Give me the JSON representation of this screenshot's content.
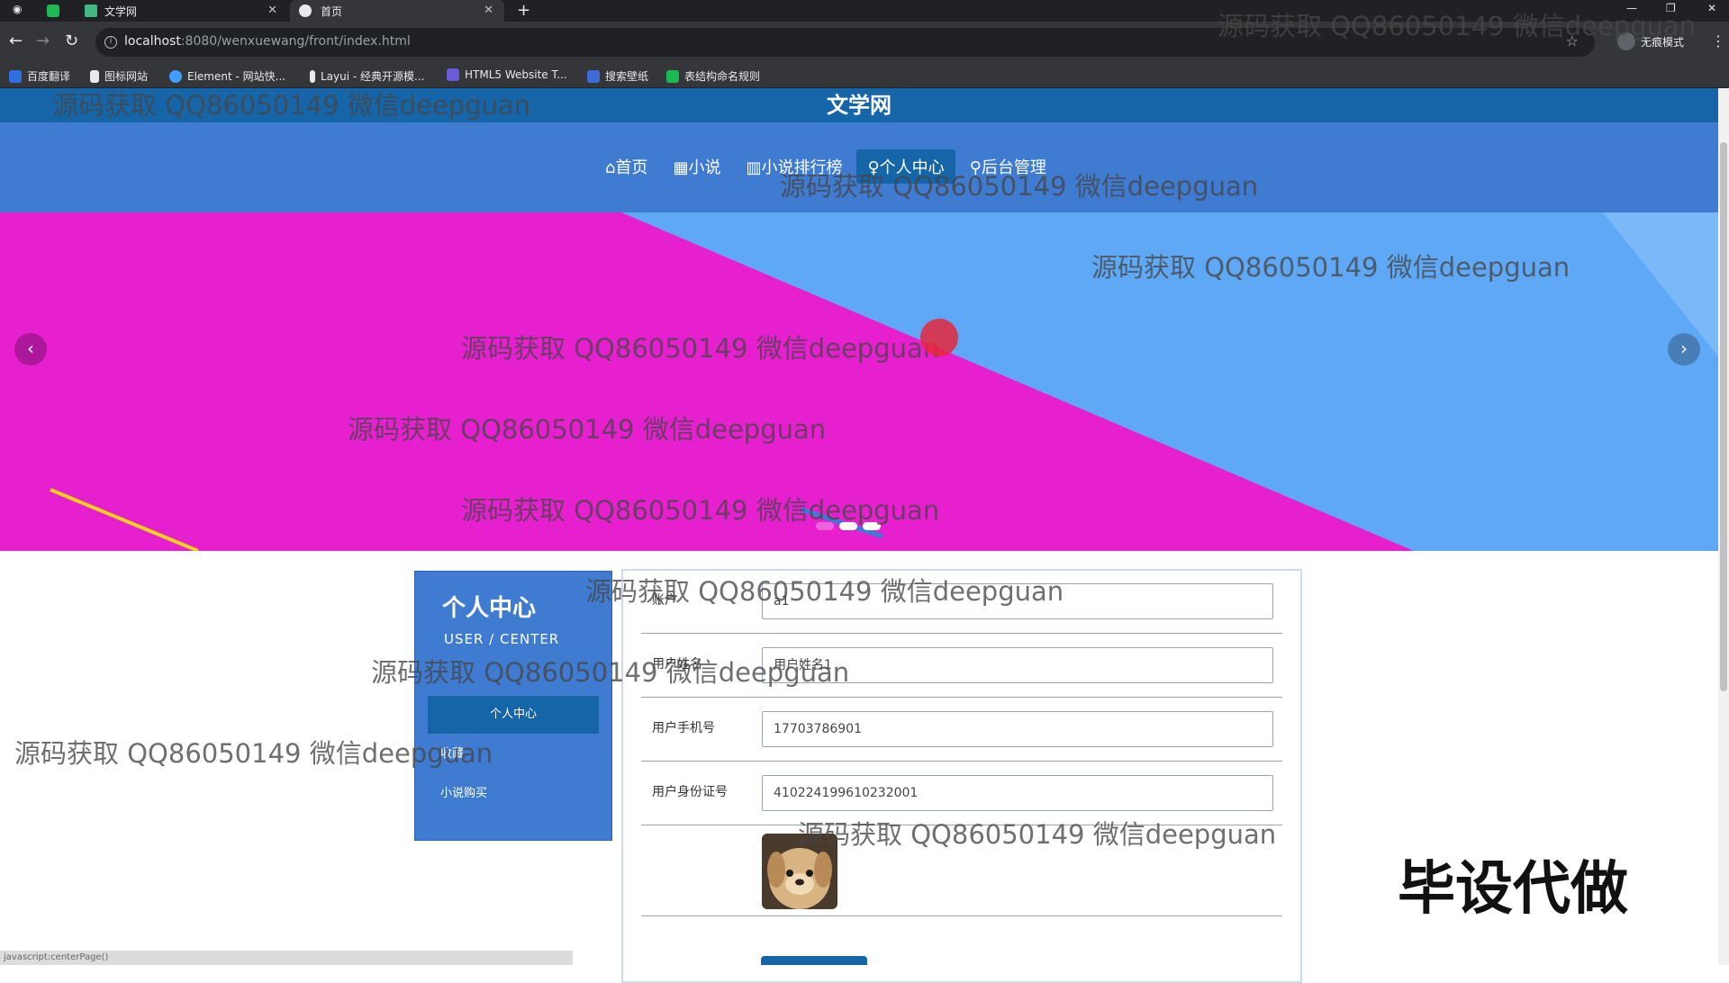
{
  "browser": {
    "tabs": [
      {
        "title": "文学网"
      },
      {
        "title": "首页"
      }
    ],
    "url_host": "localhost",
    "url_rest": ":8080/wenxuewang/front/index.html",
    "incognito_label": "无痕模式",
    "bookmarks": [
      "百度翻译",
      "图标网站",
      "Element - 网站快...",
      "Layui - 经典开源模...",
      "HTML5 Website T...",
      "搜索壁纸",
      "表结构命名规则"
    ]
  },
  "site": {
    "title": "文学网",
    "nav": [
      {
        "icon": "home-icon",
        "label": "⌂首页"
      },
      {
        "icon": "novel-icon",
        "label": "▦小说"
      },
      {
        "icon": "rank-icon",
        "label": "▥小说排行榜"
      },
      {
        "icon": "user-icon",
        "label": "♀个人中心"
      },
      {
        "icon": "link-icon",
        "label": "⚲后台管理"
      }
    ],
    "active_nav_index": 3,
    "banner_active_dot": 2
  },
  "sidebar": {
    "title": "个人中心",
    "subtitle": "USER / CENTER",
    "items": [
      "个人中心",
      "收藏",
      "小说购买"
    ]
  },
  "form": {
    "fields": [
      {
        "label": "账户",
        "value": "a1"
      },
      {
        "label": "用户姓名",
        "value": "用户姓名1"
      },
      {
        "label": "用户手机号",
        "value": "17703786901"
      },
      {
        "label": "用户身份证号",
        "value": "410224199610232001"
      }
    ]
  },
  "overlay": {
    "watermark_text": "源码获取 QQ86050149 微信deepguan",
    "promo_text": "毕设代做",
    "status_text": "javascript:centerPage()"
  },
  "colors": {
    "header": "#1565a8",
    "navbar": "#3f7bd0",
    "banner_magenta": "#e61fcf",
    "banner_blue": "#5fa8f5"
  }
}
